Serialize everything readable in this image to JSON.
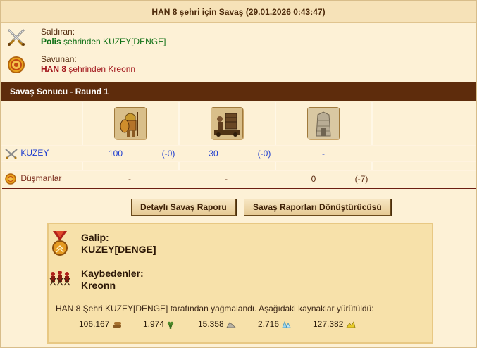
{
  "report": {
    "title": "HAN 8 şehri için Savaş (29.01.2026 0:43:47)",
    "attacker": {
      "label": "Saldıran:",
      "city_bold": "Polis",
      "city_rest": " şehrinden KUZEY[DENGE]",
      "icon": "crossed-swords-icon"
    },
    "defender": {
      "label": "Savunan:",
      "city_bold": "HAN 8",
      "city_rest": " şehrinden Kreonn",
      "icon": "shield-medallion-icon"
    }
  },
  "result": {
    "header": "Savaş Sonucu - Raund 1",
    "units": [
      "hoplite-unit-icon",
      "catapult-crew-unit-icon",
      "stone-wall-unit-icon"
    ],
    "rows": [
      {
        "name": "KUZEY",
        "icon": "crossed-swords-icon",
        "cells": [
          {
            "count": "100",
            "loss": "(-0)"
          },
          {
            "count": "30",
            "loss": "(-0)"
          },
          {
            "count": "-",
            "loss": ""
          }
        ]
      },
      {
        "name": "Düşmanlar",
        "icon": "shield-medallion-icon",
        "cells": [
          {
            "count": "-",
            "loss": ""
          },
          {
            "count": "-",
            "loss": ""
          },
          {
            "count": "0",
            "loss": "(-7)"
          }
        ]
      }
    ]
  },
  "buttons": {
    "detailed": "Detaylı Savaş Raporu",
    "converter": "Savaş Raporları Dönüştürücüsü"
  },
  "summary": {
    "winner_label": "Galip:",
    "winner_name": "KUZEY[DENGE]",
    "losers_label": "Kaybedenler:",
    "losers_name": "Kreonn",
    "plunder_text": "HAN 8 Şehri KUZEY[DENGE] tarafından yağmalandı. Aşağıdaki kaynaklar yürütüldü:",
    "resources": [
      {
        "value": "106.167",
        "icon": "wood-icon"
      },
      {
        "value": "1.974",
        "icon": "wine-icon"
      },
      {
        "value": "15.358",
        "icon": "marble-icon"
      },
      {
        "value": "2.716",
        "icon": "crystal-icon"
      },
      {
        "value": "127.382",
        "icon": "sulfur-icon"
      }
    ]
  }
}
